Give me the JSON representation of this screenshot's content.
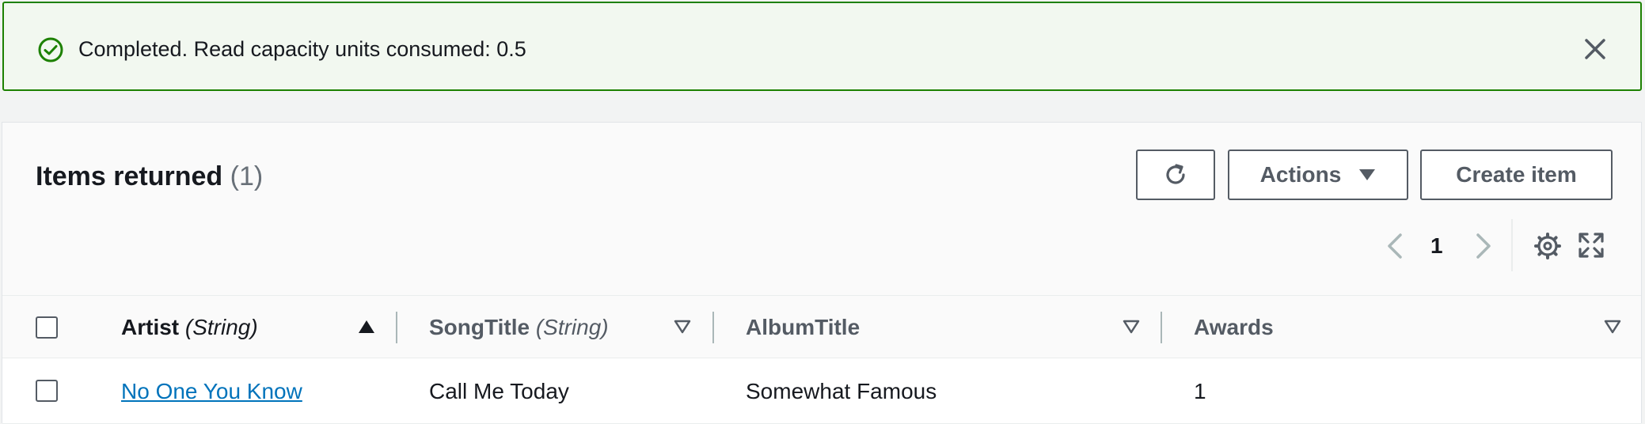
{
  "flash": {
    "message": "Completed. Read capacity units consumed: 0.5",
    "status_icon": "check-circle-icon",
    "color": "#1d8102"
  },
  "panel": {
    "title": "Items returned",
    "count": "(1)",
    "buttons": {
      "refresh_icon": "refresh-icon",
      "actions_label": "Actions",
      "create_label": "Create item"
    },
    "pagination": {
      "current_page": "1"
    }
  },
  "table": {
    "columns": [
      {
        "name": "Artist",
        "type": "(String)",
        "sort": "ascending"
      },
      {
        "name": "SongTitle",
        "type": "(String)",
        "sort": "none"
      },
      {
        "name": "AlbumTitle",
        "type": "",
        "sort": "none"
      },
      {
        "name": "Awards",
        "type": "",
        "sort": "none"
      }
    ],
    "rows": [
      {
        "Artist": "No One You Know",
        "SongTitle": "Call Me Today",
        "AlbumTitle": "Somewhat Famous",
        "Awards": "1"
      }
    ]
  },
  "colors": {
    "link": "#0073bb",
    "success": "#1d8102"
  }
}
